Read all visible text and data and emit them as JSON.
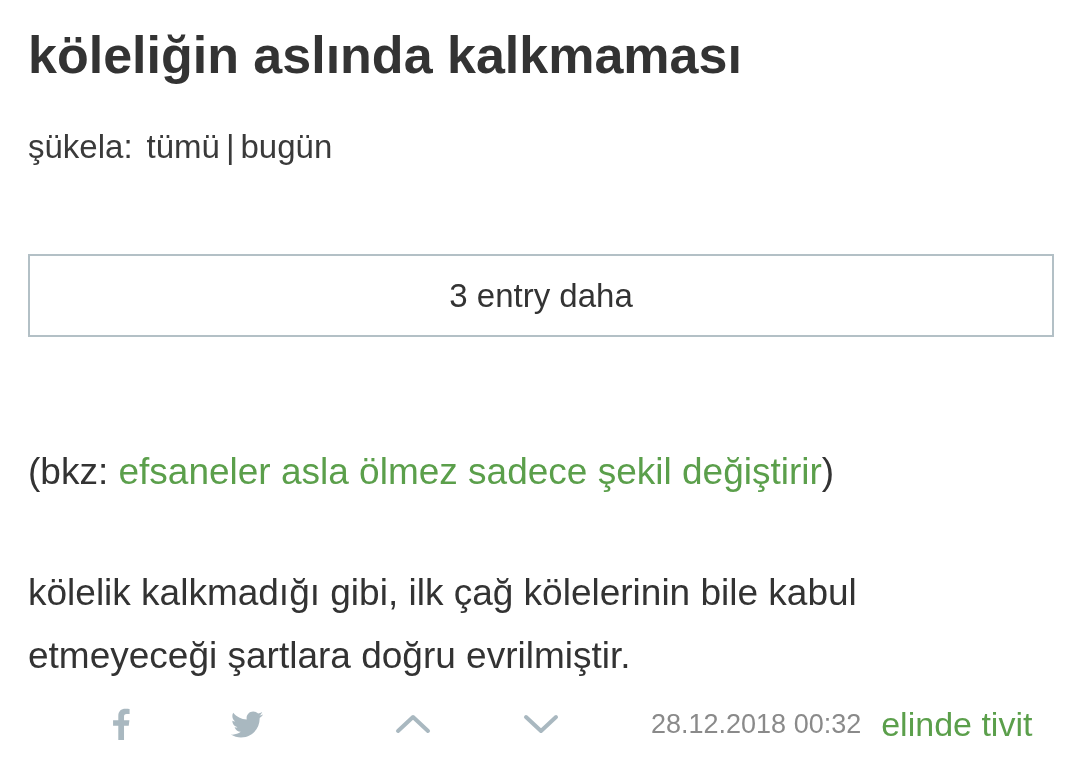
{
  "entry_title": "köleliğin aslında kalkmaması",
  "sukela_filter": {
    "label": "şükela:",
    "options": [
      "tümü",
      "bugün"
    ],
    "separator": "|"
  },
  "more_button": "3 entry daha",
  "entry": {
    "reference": {
      "prefix": "(bkz: ",
      "link": "efsaneler asla ölmez sadece şekil değiştirir",
      "suffix": ")"
    },
    "text": "kölelik kalkmadığı gibi, ilk çağ kölelerinin bile kabul etmeyeceği şartlara doğru evrilmiştir.",
    "footer": {
      "date": "28.12.2018 00:32",
      "author": "elinde tivit"
    }
  }
}
